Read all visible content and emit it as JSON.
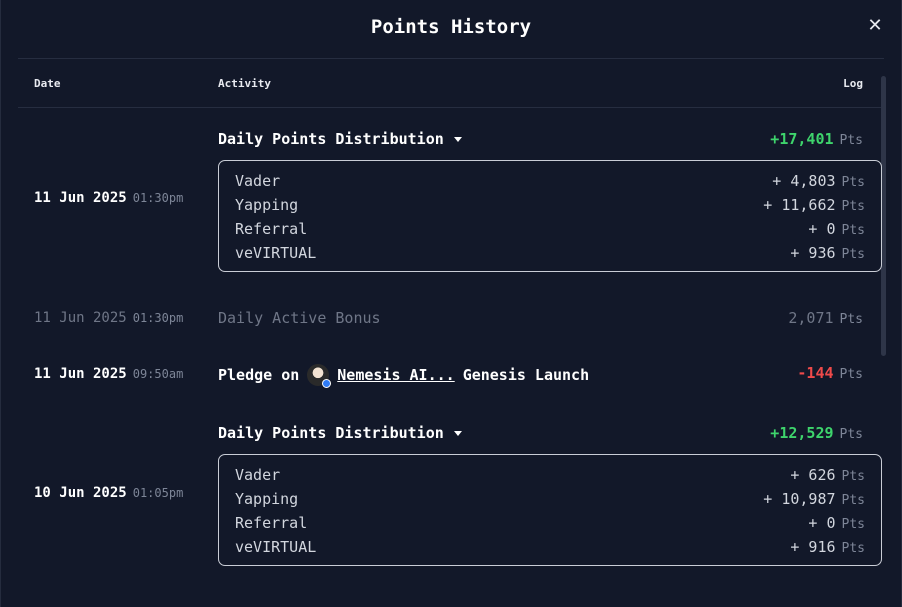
{
  "title": "Points History",
  "columns": {
    "date": "Date",
    "activity": "Activity",
    "log": "Log"
  },
  "unit": "Pts",
  "rows": [
    {
      "date": "11 Jun 2025",
      "time": "01:30pm",
      "activity": "Daily Points Distribution",
      "log": "+17,401",
      "breakdown": [
        {
          "label": "Vader",
          "value": "+ 4,803"
        },
        {
          "label": "Yapping",
          "value": "+ 11,662"
        },
        {
          "label": "Referral",
          "value": "+ 0"
        },
        {
          "label": "veVIRTUAL",
          "value": "+ 936"
        }
      ]
    },
    {
      "date": "11 Jun 2025",
      "time": "01:30pm",
      "activity": "Daily Active Bonus",
      "log": "2,071"
    },
    {
      "date": "11 Jun 2025",
      "time": "09:50am",
      "activity_prefix": "Pledge on",
      "activity_link": "Nemesis AI...",
      "activity_suffix": "Genesis Launch",
      "log": "-144"
    },
    {
      "date": "10 Jun 2025",
      "time": "01:05pm",
      "activity": "Daily Points Distribution",
      "log": "+12,529",
      "breakdown": [
        {
          "label": "Vader",
          "value": "+ 626"
        },
        {
          "label": "Yapping",
          "value": "+ 10,987"
        },
        {
          "label": "Referral",
          "value": "+ 0"
        },
        {
          "label": "veVIRTUAL",
          "value": "+ 916"
        }
      ]
    }
  ],
  "colors": {
    "positive": "#3ed46c",
    "negative": "#ef4a4a",
    "background": "#121829"
  }
}
